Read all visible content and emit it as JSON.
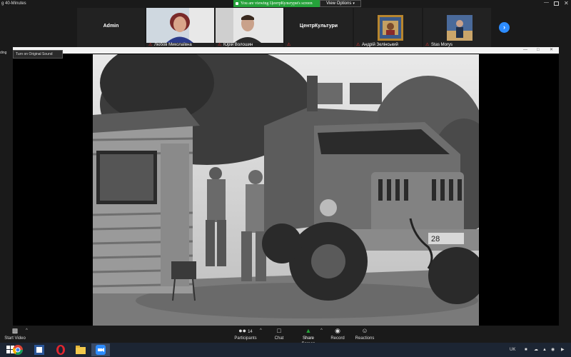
{
  "topbar": {
    "timer_text": "g 40-Minutes",
    "share_banner": "You are viewing ЦентрКультури's screen",
    "view_options": "View Options",
    "view_options_caret": "▾",
    "minimize": "—",
    "close": "✕"
  },
  "participants": [
    {
      "name": "Admin",
      "caption": "",
      "type": "name-only",
      "muted": false
    },
    {
      "name": "",
      "caption": "Любов Миколаївна",
      "type": "video-woman",
      "muted": true
    },
    {
      "name": "",
      "caption": "Юрій Волошин",
      "type": "video-man",
      "muted": true
    },
    {
      "name": "ЦентрКультури",
      "caption": "",
      "type": "name-only",
      "muted": true
    },
    {
      "name": "",
      "caption": "Андрій Зелінський",
      "type": "avatar",
      "muted": true
    },
    {
      "name": "",
      "caption": "Stas Morys",
      "type": "avatar2",
      "muted": true
    }
  ],
  "mic_icon_glyph": "⚠",
  "next_arrow": "›",
  "share": {
    "original_sound": "Turn on Original Sound",
    "left_label": "ding",
    "window_minimize": "—",
    "window_restore": "□",
    "window_close": "✕"
  },
  "photo": {
    "plate_text": "28",
    "bumper_number": "2"
  },
  "toolbar": {
    "start_video": "Start Video",
    "participants": "Participants",
    "participants_count": "14",
    "chat": "Chat",
    "share_screen": "Share Screen",
    "record": "Record",
    "reactions": "Reactions",
    "caret": "^"
  },
  "taskbar": {
    "language": "UK",
    "active_color": "#3b4b66"
  }
}
